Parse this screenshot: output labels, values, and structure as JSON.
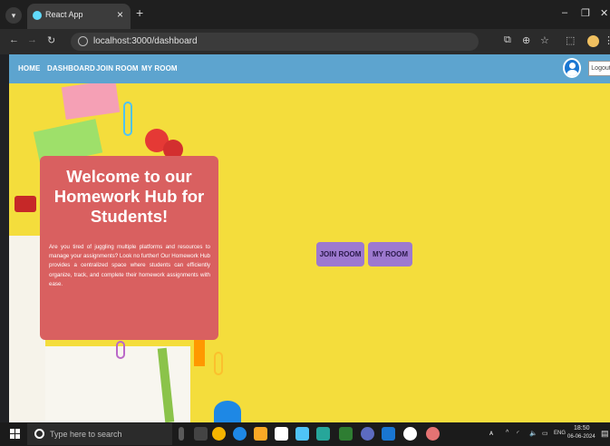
{
  "browser": {
    "tab_title": "React App",
    "tab_close": "×",
    "new_tab": "+",
    "url": "localhost:3000/dashboard",
    "win_min": "–",
    "win_max": "❐",
    "win_close": "✕"
  },
  "nav": {
    "items": [
      "HOME",
      "DASHBOARD",
      "JOIN ROOM",
      "MY ROOM"
    ],
    "logout_label": "Logout"
  },
  "welcome": {
    "title": "Welcome to our Homework Hub for Students!",
    "text": "Are you tired of juggling multiple platforms and resources to manage your assignments? Look no further! Our Homework Hub provides a centralized space where students can efficiently organize, track, and complete their homework assignments with ease."
  },
  "actions": {
    "join_room": "JOIN ROOM",
    "my_room": "MY ROOM"
  },
  "taskbar": {
    "search_placeholder": "Type here to search",
    "language": "ENG",
    "time": "18:50",
    "date": "06-06-2024"
  },
  "colors": {
    "nav_bar": "#5da4cf",
    "hero_background": "#f4dd3c",
    "welcome_card": "#d96060",
    "action_button": "#9d79cf"
  }
}
